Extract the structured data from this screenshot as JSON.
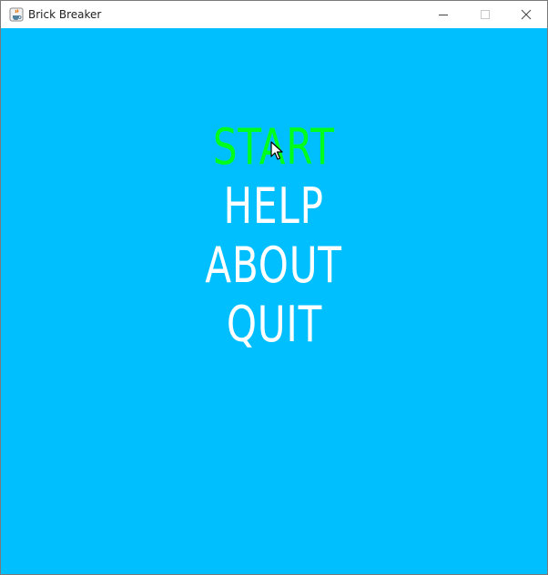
{
  "window": {
    "title": "Brick Breaker",
    "app_icon": "java-cup-icon",
    "controls": {
      "minimize_icon": "minimize-icon",
      "maximize_icon": "maximize-icon",
      "close_icon": "close-icon"
    }
  },
  "game": {
    "background_color": "#00bfff",
    "menu": {
      "items": [
        {
          "label": "START",
          "selected": true
        },
        {
          "label": "HELP",
          "selected": false
        },
        {
          "label": "ABOUT",
          "selected": false
        },
        {
          "label": "QUIT",
          "selected": false
        }
      ],
      "selected_color": "#00ff1a",
      "default_color": "#ffffff"
    }
  }
}
